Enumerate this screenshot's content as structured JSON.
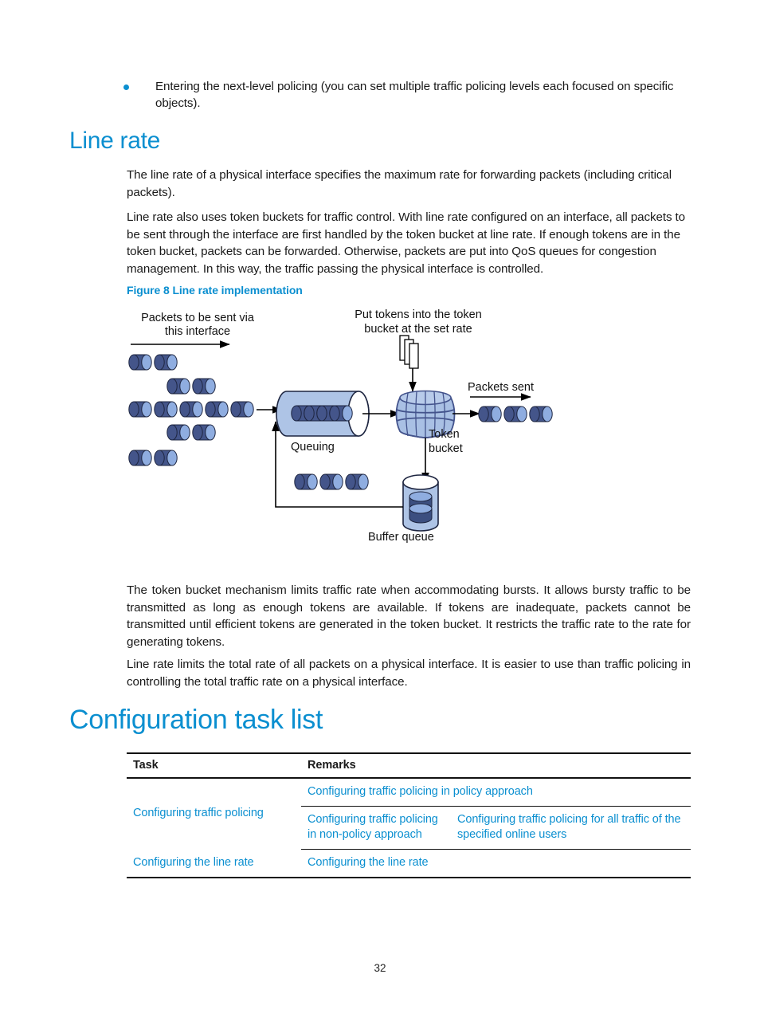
{
  "document": {
    "page_number": "32"
  },
  "colors": {
    "heading_blue": "#0b8fd0",
    "link_blue": "#0b8fd0",
    "body_text": "#1a1a1a",
    "packet_dark": "#3f5381",
    "packet_light": "#8aa9d6",
    "cylinder_fill": "#aec4e6",
    "barrel_fill": "#a9c0e4",
    "barrel_stroke": "#43538c"
  },
  "bullet": {
    "text": "Entering the next-level policing (you can set multiple traffic policing levels each focused on specific objects)."
  },
  "headings": {
    "line_rate": "Line rate",
    "configuration_task_list": "Configuration task list"
  },
  "paragraphs": {
    "p1": "The line rate of a physical interface specifies the maximum rate for forwarding packets (including critical packets).",
    "p2": "Line rate also uses token buckets for traffic control. With line rate configured on an interface, all packets to be sent through the interface are first handled by the token bucket at line rate. If enough tokens are in the token bucket, packets can be forwarded. Otherwise, packets are put into QoS queues for congestion management. In this way, the traffic passing the physical interface is controlled.",
    "p3": "The token bucket mechanism limits traffic rate when accommodating bursts. It allows bursty traffic to be transmitted as long as enough tokens are available. If tokens are inadequate, packets cannot be transmitted until efficient tokens are generated in the token bucket. It restricts the traffic rate to the rate for generating tokens.",
    "p4": "Line rate limits the total rate of all packets on a physical interface. It is easier to use than traffic policing in controlling the total traffic rate on a physical interface."
  },
  "figure": {
    "caption": "Figure 8 Line rate implementation",
    "labels": {
      "packets_to_be_sent": "Packets to be sent via\nthis interface",
      "packets_to_be_sent_line1": "Packets to be sent via",
      "packets_to_be_sent_line2": "this interface",
      "put_tokens_line1": "Put tokens into the token",
      "put_tokens_line2": "bucket at the set rate",
      "packets_sent": "Packets sent",
      "queuing": "Queuing",
      "token_bucket_line1": "Token",
      "token_bucket_line2": "bucket",
      "buffer_queue": "Buffer queue"
    }
  },
  "table": {
    "headers": [
      "Task",
      "Remarks"
    ],
    "rows": [
      {
        "task": "Configuring traffic policing",
        "remarks": [
          {
            "primary": "Configuring traffic policing in policy approach",
            "secondary": ""
          },
          {
            "primary": "Configuring traffic policing in non-policy approach",
            "secondary": "Configuring traffic policing for all traffic of the specified online users"
          }
        ]
      },
      {
        "task": "Configuring the line rate",
        "remarks": [
          {
            "primary": "Configuring the line rate",
            "secondary": ""
          }
        ]
      }
    ]
  }
}
